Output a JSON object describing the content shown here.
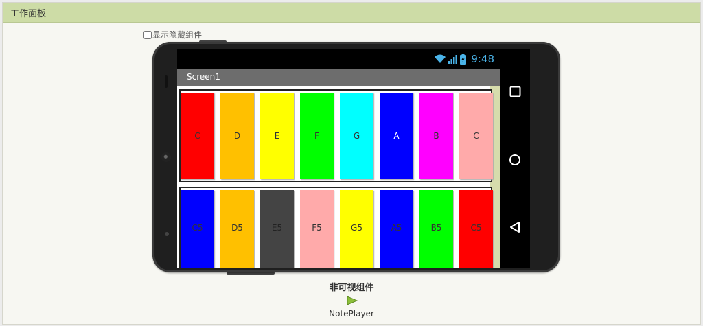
{
  "panel": {
    "title": "工作面板"
  },
  "show_hidden": {
    "label": "显示隐藏组件",
    "checked": false
  },
  "status_bar": {
    "time": "9:48"
  },
  "screen": {
    "title": "Screen1"
  },
  "row1": [
    {
      "label": "C",
      "color": "#ff0000",
      "text_color": "#333333"
    },
    {
      "label": "D",
      "color": "#ffc000",
      "text_color": "#333333"
    },
    {
      "label": "E",
      "color": "#ffff00",
      "text_color": "#333333"
    },
    {
      "label": "F",
      "color": "#00ff00",
      "text_color": "#333333"
    },
    {
      "label": "G",
      "color": "#00ffff",
      "text_color": "#333333"
    },
    {
      "label": "A",
      "color": "#0000ff",
      "text_color": "#ffffff"
    },
    {
      "label": "B",
      "color": "#ff00ff",
      "text_color": "#333333"
    },
    {
      "label": "C",
      "color": "#ffaaaa",
      "text_color": "#333333"
    }
  ],
  "row2": [
    {
      "label": "C5",
      "color": "#0000ff",
      "text_color": "#333333"
    },
    {
      "label": "D5",
      "color": "#ffc000",
      "text_color": "#333333"
    },
    {
      "label": "E5",
      "color": "#444444",
      "text_color": "#222222"
    },
    {
      "label": "F5",
      "color": "#ffaaaa",
      "text_color": "#333333"
    },
    {
      "label": "G5",
      "color": "#ffff00",
      "text_color": "#333333"
    },
    {
      "label": "A5",
      "color": "#0000ff",
      "text_color": "#333333"
    },
    {
      "label": "B5",
      "color": "#00ff00",
      "text_color": "#333333"
    },
    {
      "label": "C5",
      "color": "#ff0000",
      "text_color": "#333333"
    }
  ],
  "nonvisible": {
    "title": "非可视组件",
    "component": {
      "label": "NotePlayer",
      "icon": "play-icon"
    }
  }
}
